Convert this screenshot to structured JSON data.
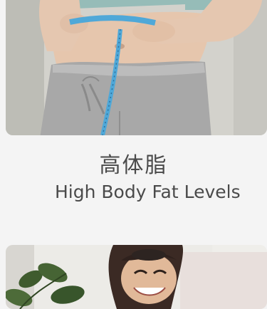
{
  "cards": [
    {
      "title_cn": "高体脂",
      "title_en": "High Body Fat Levels",
      "image_name": "measuring-waist-photo"
    },
    {
      "image_name": "smiling-person-with-plant-photo"
    }
  ],
  "colors": {
    "background": "#f4f4f4",
    "text": "#4a4a4a",
    "tape": "#4fa8d8"
  }
}
